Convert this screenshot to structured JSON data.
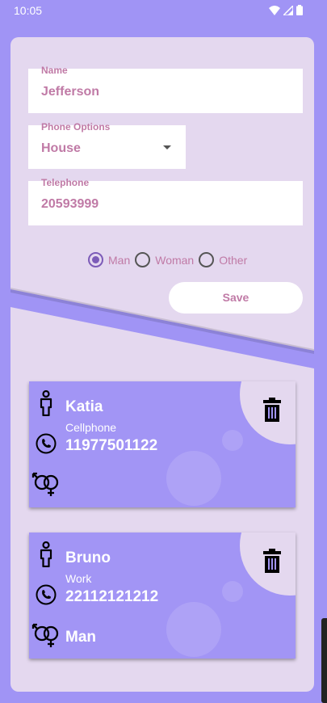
{
  "status_bar": {
    "time": "10:05"
  },
  "form": {
    "name": {
      "label": "Name",
      "value": "Jefferson"
    },
    "phone_options": {
      "label": "Phone Options",
      "value": "House"
    },
    "telephone": {
      "label": "Telephone",
      "value": "20593999"
    },
    "gender_options": [
      {
        "label": "Man",
        "checked": true
      },
      {
        "label": "Woman",
        "checked": false
      },
      {
        "label": "Other",
        "checked": false
      }
    ],
    "save_label": "Save"
  },
  "contacts": [
    {
      "name": "Katia",
      "phone_type": "Cellphone",
      "phone": "11977501122",
      "gender": ""
    },
    {
      "name": "Bruno",
      "phone_type": "Work",
      "phone": "22112121212",
      "gender": "Man"
    }
  ],
  "colors": {
    "background": "#a094f5",
    "panel": "#e4d8ef",
    "card": "#a295f5",
    "text_accent": "#c07aa6",
    "radio_checked": "#7c5bb8"
  }
}
